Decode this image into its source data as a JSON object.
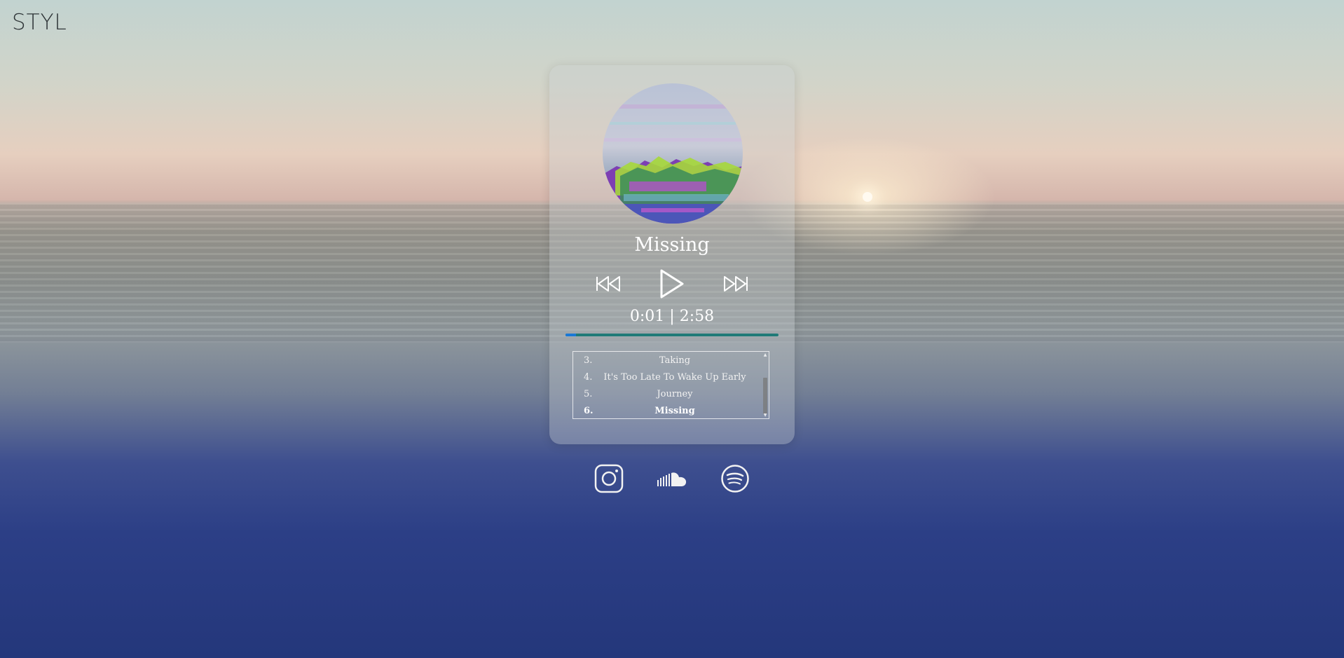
{
  "brand": {
    "logo_text": "STYL"
  },
  "player": {
    "track_title": "Missing",
    "elapsed": "0:01",
    "separator": "|",
    "duration": "2:58",
    "progress_fraction": 0.006
  },
  "controls": {
    "previous_icon": "skip-back-icon",
    "play_icon": "play-icon",
    "next_icon": "skip-forward-icon"
  },
  "playlist": {
    "items": [
      {
        "num": "3.",
        "title": "Taking"
      },
      {
        "num": "4.",
        "title": "It's Too Late To Wake Up Early"
      },
      {
        "num": "5.",
        "title": "Journey"
      },
      {
        "num": "6.",
        "title": "Missing"
      }
    ],
    "active_index": 3
  },
  "socials": [
    {
      "icon": "instagram-icon"
    },
    {
      "icon": "soundcloud-icon"
    },
    {
      "icon": "spotify-icon"
    }
  ],
  "colors": {
    "progress_fill": "#1a78d6",
    "progress_track": "#207a78"
  }
}
